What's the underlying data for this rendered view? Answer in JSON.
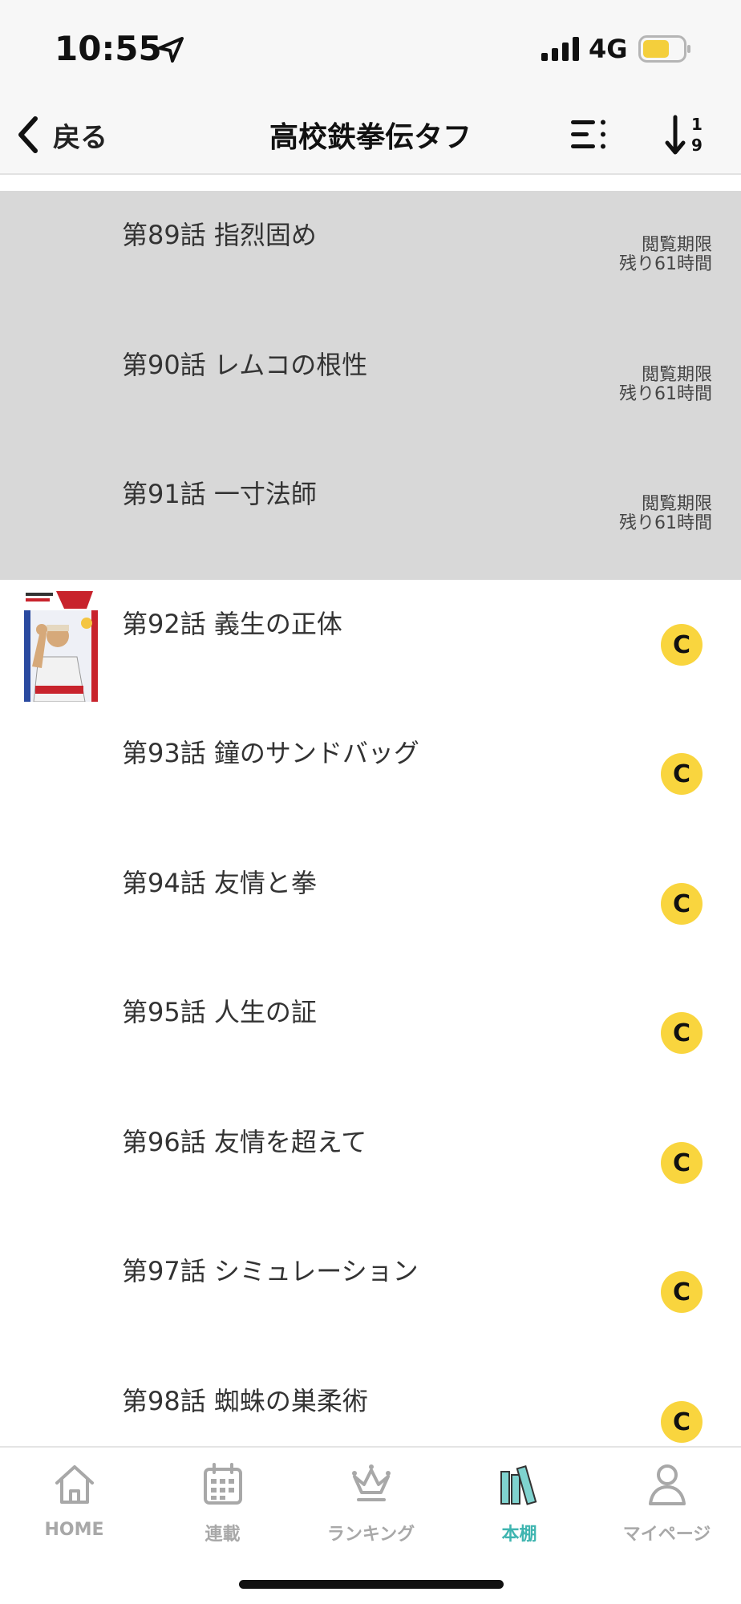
{
  "status_bar": {
    "time": "10:55",
    "network": "4G",
    "icons": [
      "location-arrow-icon",
      "signal-icon",
      "battery-icon"
    ],
    "battery_color": "#f4cf3c"
  },
  "nav": {
    "back_label": "戻る",
    "title": "高校鉄拳伝タフ",
    "icons": [
      "chevron-left-icon",
      "list-icon",
      "sort-order-icon"
    ]
  },
  "colors": {
    "read_row_bg": "#d8d8d8",
    "coin": "#f9d53e",
    "tab_active": "#3fb5b0",
    "tab_inactive": "#a8a8a8"
  },
  "episodes": [
    {
      "title": "第89話 指烈固め",
      "read": true,
      "deadline_line1": "閲覧期限",
      "deadline_line2": "残り61時間"
    },
    {
      "title": "第90話 レムコの根性",
      "read": true,
      "deadline_line1": "閲覧期限",
      "deadline_line2": "残り61時間"
    },
    {
      "title": "第91話 一寸法師",
      "read": true,
      "deadline_line1": "閲覧期限",
      "deadline_line2": "残り61時間"
    },
    {
      "title": "第92話 義生の正体",
      "read": false,
      "coin_label": "C",
      "has_thumbnail": true
    },
    {
      "title": "第93話 鐘のサンドバッグ",
      "read": false,
      "coin_label": "C"
    },
    {
      "title": "第94話 友情と拳",
      "read": false,
      "coin_label": "C"
    },
    {
      "title": "第95話 人生の証",
      "read": false,
      "coin_label": "C"
    },
    {
      "title": "第96話 友情を超えて",
      "read": false,
      "coin_label": "C"
    },
    {
      "title": "第97話 シミュレーション",
      "read": false,
      "coin_label": "C"
    },
    {
      "title": "第98話 蜘蛛の巣柔術",
      "read": false,
      "coin_label": "C"
    }
  ],
  "tabs": [
    {
      "label": "HOME",
      "icon": "home-icon",
      "active": false
    },
    {
      "label": "連載",
      "icon": "calendar-icon",
      "active": false
    },
    {
      "label": "ランキング",
      "icon": "crown-icon",
      "active": false
    },
    {
      "label": "本棚",
      "icon": "bookshelf-icon",
      "active": true
    },
    {
      "label": "マイページ",
      "icon": "person-icon",
      "active": false
    }
  ]
}
